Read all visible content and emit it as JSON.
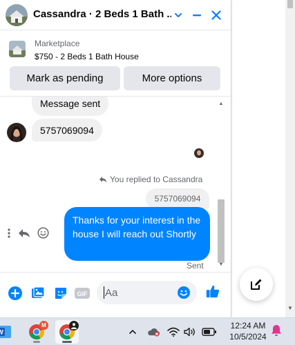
{
  "colors": {
    "accent": "#0084ff",
    "header_icon": "#0a7cff",
    "bubble_in": "#f0f0f0",
    "action_button_bg": "#e4e6eb",
    "secondary_text": "#65676b",
    "taskbar_bg": "#dfe4ec"
  },
  "chat": {
    "title": "Cassandra · 2 Beds 1 Bath ...",
    "header_icons": [
      "chevron-down-icon",
      "minimize-icon",
      "close-icon"
    ],
    "marketplace": {
      "label": "Marketplace",
      "item": "$750 - 2 Beds 1 Bath House",
      "buttons": [
        "Mark as pending",
        "More options"
      ]
    },
    "messages": {
      "partial_incoming": "Message sent",
      "incoming": "5757069094",
      "replied_label": "You replied to Cassandra",
      "quoted_text": "5757069094",
      "outgoing": "Thanks for your interest in the house I will reach out Shortly",
      "status": "Sent"
    },
    "composer": {
      "placeholder": "Aa",
      "icons": [
        "add-icon",
        "photo-icon",
        "sticker-icon",
        "gif-icon",
        "emoji-icon",
        "like-icon"
      ]
    }
  },
  "taskbar": {
    "apps": [
      "word-icon",
      "chrome-icon",
      "chrome-profile-icon"
    ],
    "chrome_badge": "M",
    "time": "12:24 AM",
    "date": "10/5/2024",
    "tray_icons": [
      "chevron-up-icon",
      "onedrive-icon",
      "wifi-icon",
      "volume-icon",
      "battery-icon",
      "notification-bell-icon"
    ]
  }
}
